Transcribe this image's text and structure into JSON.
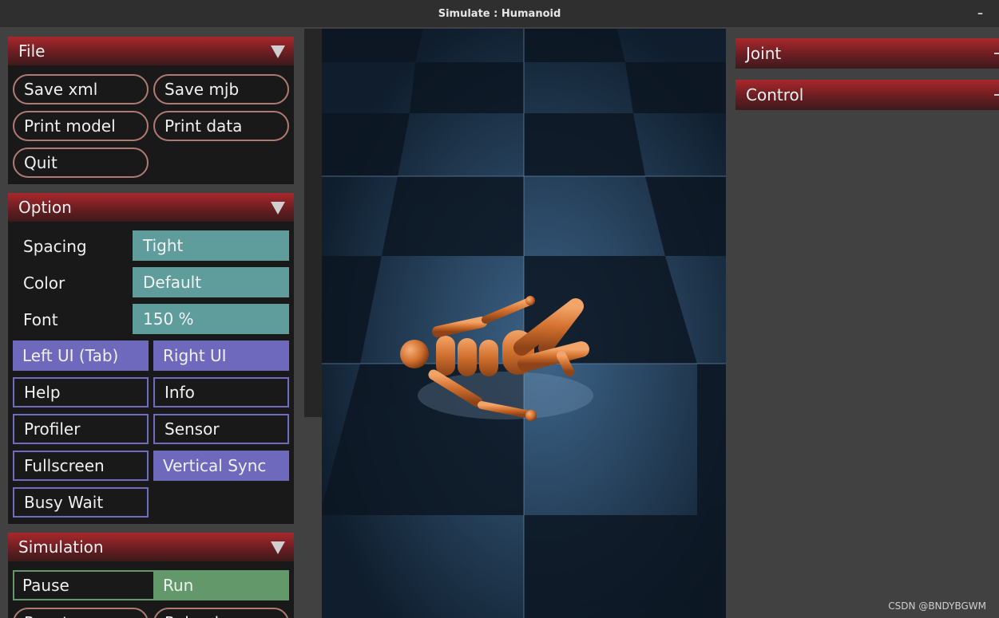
{
  "window": {
    "title": "Simulate : Humanoid",
    "minimize": "–"
  },
  "file": {
    "title": "File",
    "save_xml": "Save xml",
    "save_mjb": "Save mjb",
    "print_model": "Print model",
    "print_data": "Print data",
    "quit": "Quit"
  },
  "option": {
    "title": "Option",
    "spacing_label": "Spacing",
    "spacing_value": "Tight",
    "color_label": "Color",
    "color_value": "Default",
    "font_label": "Font",
    "font_value": "150 %",
    "left_ui": "Left UI (Tab)",
    "right_ui": "Right UI",
    "help": "Help",
    "info": "Info",
    "profiler": "Profiler",
    "sensor": "Sensor",
    "fullscreen": "Fullscreen",
    "vertical_sync": "Vertical Sync",
    "busy_wait": "Busy Wait"
  },
  "simulation": {
    "title": "Simulation",
    "pause": "Pause",
    "run": "Run",
    "reset_partial": "Reset",
    "reload_partial": "Reload"
  },
  "right": {
    "joint": "Joint",
    "control": "Control"
  },
  "watermark": "CSDN @BNDYBGWM",
  "colors": {
    "header_red": "#a8282c",
    "select_teal": "#5f9c9c",
    "toggle_purple": "#6e69bd",
    "run_green": "#63996a",
    "humanoid_orange": "#d06f2e"
  }
}
